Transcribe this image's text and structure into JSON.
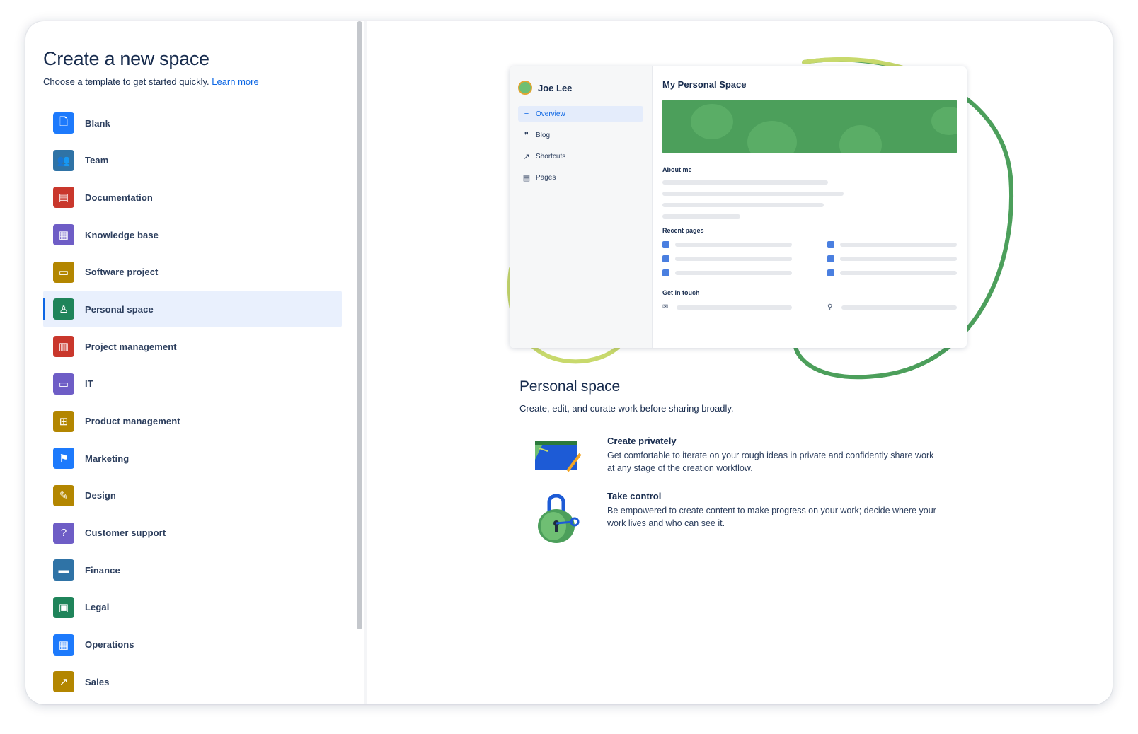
{
  "header": {
    "title": "Create a new space",
    "subtitle": "Choose a template to get started quickly.",
    "learn_more": "Learn more"
  },
  "templates": [
    {
      "label": "Blank",
      "icon": "page-icon",
      "color": "#1d7afc",
      "glyph": "🗋"
    },
    {
      "label": "Team",
      "icon": "people-icon",
      "color": "#2f73a6",
      "glyph": "👥"
    },
    {
      "label": "Documentation",
      "icon": "archive-icon",
      "color": "#c9372c",
      "glyph": "▤"
    },
    {
      "label": "Knowledge base",
      "icon": "book-icon",
      "color": "#6e5dc6",
      "glyph": "▦"
    },
    {
      "label": "Software project",
      "icon": "monitor-icon",
      "color": "#b38600",
      "glyph": "▭"
    },
    {
      "label": "Personal space",
      "icon": "person-icon",
      "color": "#1f845a",
      "glyph": "♙",
      "selected": true
    },
    {
      "label": "Project management",
      "icon": "document-icon",
      "color": "#c9372c",
      "glyph": "▥"
    },
    {
      "label": "IT",
      "icon": "desktop-icon",
      "color": "#6e5dc6",
      "glyph": "▭"
    },
    {
      "label": "Product management",
      "icon": "grid-icon",
      "color": "#b38600",
      "glyph": "⊞"
    },
    {
      "label": "Marketing",
      "icon": "flag-icon",
      "color": "#1d7afc",
      "glyph": "⚑"
    },
    {
      "label": "Design",
      "icon": "pencil-icon",
      "color": "#b38600",
      "glyph": "✎"
    },
    {
      "label": "Customer support",
      "icon": "question-icon",
      "color": "#6e5dc6",
      "glyph": "?"
    },
    {
      "label": "Finance",
      "icon": "card-icon",
      "color": "#2f73a6",
      "glyph": "▬"
    },
    {
      "label": "Legal",
      "icon": "briefcase-icon",
      "color": "#1f845a",
      "glyph": "▣"
    },
    {
      "label": "Operations",
      "icon": "table-icon",
      "color": "#1d7afc",
      "glyph": "▦"
    },
    {
      "label": "Sales",
      "icon": "chart-icon",
      "color": "#b38600",
      "glyph": "↗"
    }
  ],
  "preview": {
    "user_name": "Joe Lee",
    "nav": [
      {
        "label": "Overview",
        "icon": "overview-icon",
        "glyph": "≡",
        "active": true
      },
      {
        "label": "Blog",
        "icon": "quote-icon",
        "glyph": "❞"
      },
      {
        "label": "Shortcuts",
        "icon": "external-link-icon",
        "glyph": "↗"
      },
      {
        "label": "Pages",
        "icon": "pages-icon",
        "glyph": "▤"
      }
    ],
    "page_title": "My Personal Space",
    "about_me": "About me",
    "recent_pages": "Recent pages",
    "get_in_touch": "Get in touch",
    "banner_color": "#4c9f5b",
    "accent_line_color": "#4c9f5b",
    "accent_line_color2": "#c8d96c"
  },
  "detail": {
    "title": "Personal space",
    "description": "Create, edit, and curate work before sharing broadly.",
    "features": [
      {
        "title": "Create privately",
        "description": "Get comfortable to iterate on your rough ideas in private and confidently share work at any stage of the creation workflow.",
        "icon": "drawing-board-illustration"
      },
      {
        "title": "Take control",
        "description": "Be empowered to create content to make progress on your work; decide where your work lives and who can see it.",
        "icon": "padlock-illustration"
      }
    ]
  }
}
